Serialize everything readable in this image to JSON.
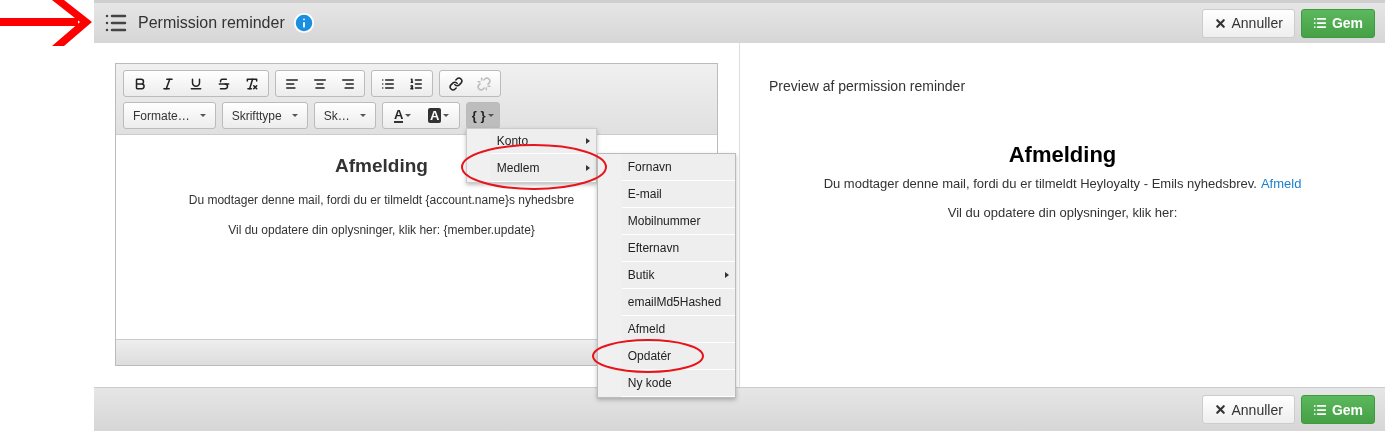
{
  "header": {
    "title": "Permission reminder",
    "pointed_at": true,
    "buttons": [
      {
        "kind": "cancel",
        "label": "Annuller"
      },
      {
        "kind": "save",
        "label": "Gem"
      }
    ]
  },
  "editor": {
    "toolbar_row_1": [
      [
        {
          "kind": "bold",
          "disabled": false
        },
        {
          "kind": "italic",
          "disabled": false
        },
        {
          "kind": "underline",
          "disabled": false
        },
        {
          "kind": "strike",
          "disabled": false
        },
        {
          "kind": "clear",
          "disabled": false
        }
      ],
      [
        {
          "kind": "align_left",
          "disabled": false
        },
        {
          "kind": "align_center",
          "disabled": false
        },
        {
          "kind": "align_right",
          "disabled": false
        }
      ],
      [
        {
          "kind": "bullets",
          "disabled": false
        },
        {
          "kind": "numbers",
          "disabled": false
        }
      ],
      [
        {
          "kind": "link",
          "disabled": false
        },
        {
          "kind": "unlink",
          "disabled": true
        }
      ]
    ],
    "dropdowns": [
      {
        "label": "Formate…"
      },
      {
        "label": "Skrifttype"
      },
      {
        "label": "Sk…"
      }
    ],
    "color_buttons": [
      {
        "kind": "text_color",
        "label": "A"
      },
      {
        "kind": "bg_color",
        "label": "A"
      }
    ],
    "variables_button": {
      "label": "{ }",
      "pressed": true
    },
    "menu": [
      {
        "label": "Konto",
        "has_submenu": true,
        "circled": false
      },
      {
        "label": "Medlem",
        "has_submenu": true,
        "circled": true,
        "children": [
          {
            "label": "Fornavn",
            "has_submenu": false,
            "circled": false
          },
          {
            "label": "E-mail",
            "has_submenu": false,
            "circled": false
          },
          {
            "label": "Mobilnummer",
            "has_submenu": false,
            "circled": false
          },
          {
            "label": "Efternavn",
            "has_submenu": false,
            "circled": false
          },
          {
            "label": "Butik",
            "has_submenu": true,
            "circled": false
          },
          {
            "label": "emailMd5Hashed",
            "has_submenu": false,
            "circled": false
          },
          {
            "label": "Afmeld",
            "has_submenu": false,
            "circled": false
          },
          {
            "label": "Opdatér",
            "has_submenu": false,
            "circled": true
          },
          {
            "label": "Ny kode",
            "has_submenu": false,
            "circled": false
          }
        ]
      }
    ],
    "content": {
      "heading": "Afmelding",
      "paragraphs": [
        "Du modtager denne mail, fordi du er tilmeldt {account.name}s nyhedsbre",
        "Vil du opdatere din oplysninger, klik her: {member.update}"
      ]
    }
  },
  "preview": {
    "title": "Preview af permission reminder",
    "heading": "Afmelding",
    "paragraph_1": "Du modtager denne mail, fordi du er tilmeldt Heyloyalty - Emils nyhedsbrev.",
    "link": "Afmeld",
    "paragraph_2": "Vil du opdatere din oplysninger, klik her:"
  },
  "footer": {
    "buttons": [
      {
        "kind": "cancel",
        "label": "Annuller"
      },
      {
        "kind": "save",
        "label": "Gem"
      }
    ]
  }
}
